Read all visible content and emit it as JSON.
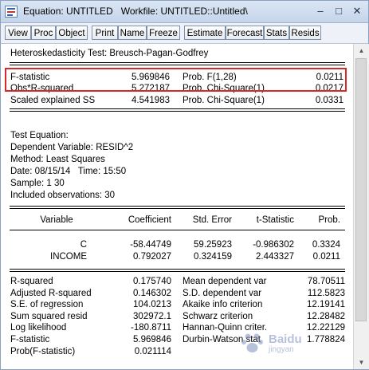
{
  "window": {
    "title": "Equation: UNTITLED   Workfile: UNTITLED::Untitled\\",
    "icon": "eviews-equation-icon",
    "controls": {
      "minimize": "–",
      "maximize": "□",
      "close": "✕"
    }
  },
  "toolbar": {
    "buttons": [
      "View",
      "Proc",
      "Object",
      "Print",
      "Name",
      "Freeze",
      "Estimate",
      "Forecast",
      "Stats",
      "Resids"
    ]
  },
  "test": {
    "heading": "Heteroskedasticity Test: Breusch-Pagan-Godfrey",
    "rows": [
      {
        "stat": "F-statistic",
        "value": "5.969846",
        "dist": "Prob. F(1,28)",
        "prob": "0.0211"
      },
      {
        "stat": "Obs*R-squared",
        "value": "5.272187",
        "dist": "Prob. Chi-Square(1)",
        "prob": "0.0217"
      },
      {
        "stat": "Scaled explained SS",
        "value": "4.541983",
        "dist": "Prob. Chi-Square(1)",
        "prob": "0.0331"
      }
    ]
  },
  "equation": {
    "header": "Test Equation:",
    "dependent": "Dependent Variable: RESID^2",
    "method": "Method: Least Squares",
    "date": "Date: 08/15/14   Time: 15:50",
    "sample": "Sample: 1 30",
    "observations": "Included observations: 30"
  },
  "coef_table": {
    "columns": [
      "Variable",
      "Coefficient",
      "Std. Error",
      "t-Statistic",
      "Prob."
    ],
    "rows": [
      {
        "variable": "C",
        "coefficient": "-58.44749",
        "std_error": "59.25923",
        "t_stat": "-0.986302",
        "prob": "0.3324"
      },
      {
        "variable": "INCOME",
        "coefficient": "0.792027",
        "std_error": "0.324159",
        "t_stat": "2.443327",
        "prob": "0.0211"
      }
    ]
  },
  "summary": {
    "rows": [
      {
        "label": "R-squared",
        "value": "0.175740",
        "label2": "Mean dependent var",
        "value2": "78.70511"
      },
      {
        "label": "Adjusted R-squared",
        "value": "0.146302",
        "label2": "S.D. dependent var",
        "value2": "112.5823"
      },
      {
        "label": "S.E. of regression",
        "value": "104.0213",
        "label2": "Akaike info criterion",
        "value2": "12.19141"
      },
      {
        "label": "Sum squared resid",
        "value": "302972.1",
        "label2": "Schwarz criterion",
        "value2": "12.28482"
      },
      {
        "label": "Log likelihood",
        "value": "-180.8711",
        "label2": "Hannan-Quinn criter.",
        "value2": "12.22129"
      },
      {
        "label": "F-statistic",
        "value": "5.969846",
        "label2": "Durbin-Watson stat",
        "value2": "1.778824"
      },
      {
        "label": "Prob(F-statistic)",
        "value": "0.021114",
        "label2": "",
        "value2": ""
      }
    ]
  },
  "watermark": {
    "text": "Baidu",
    "subtext": "jingyan"
  },
  "colors": {
    "highlight_box": "#d62a2a",
    "titlebar": "#c4d4ea"
  }
}
